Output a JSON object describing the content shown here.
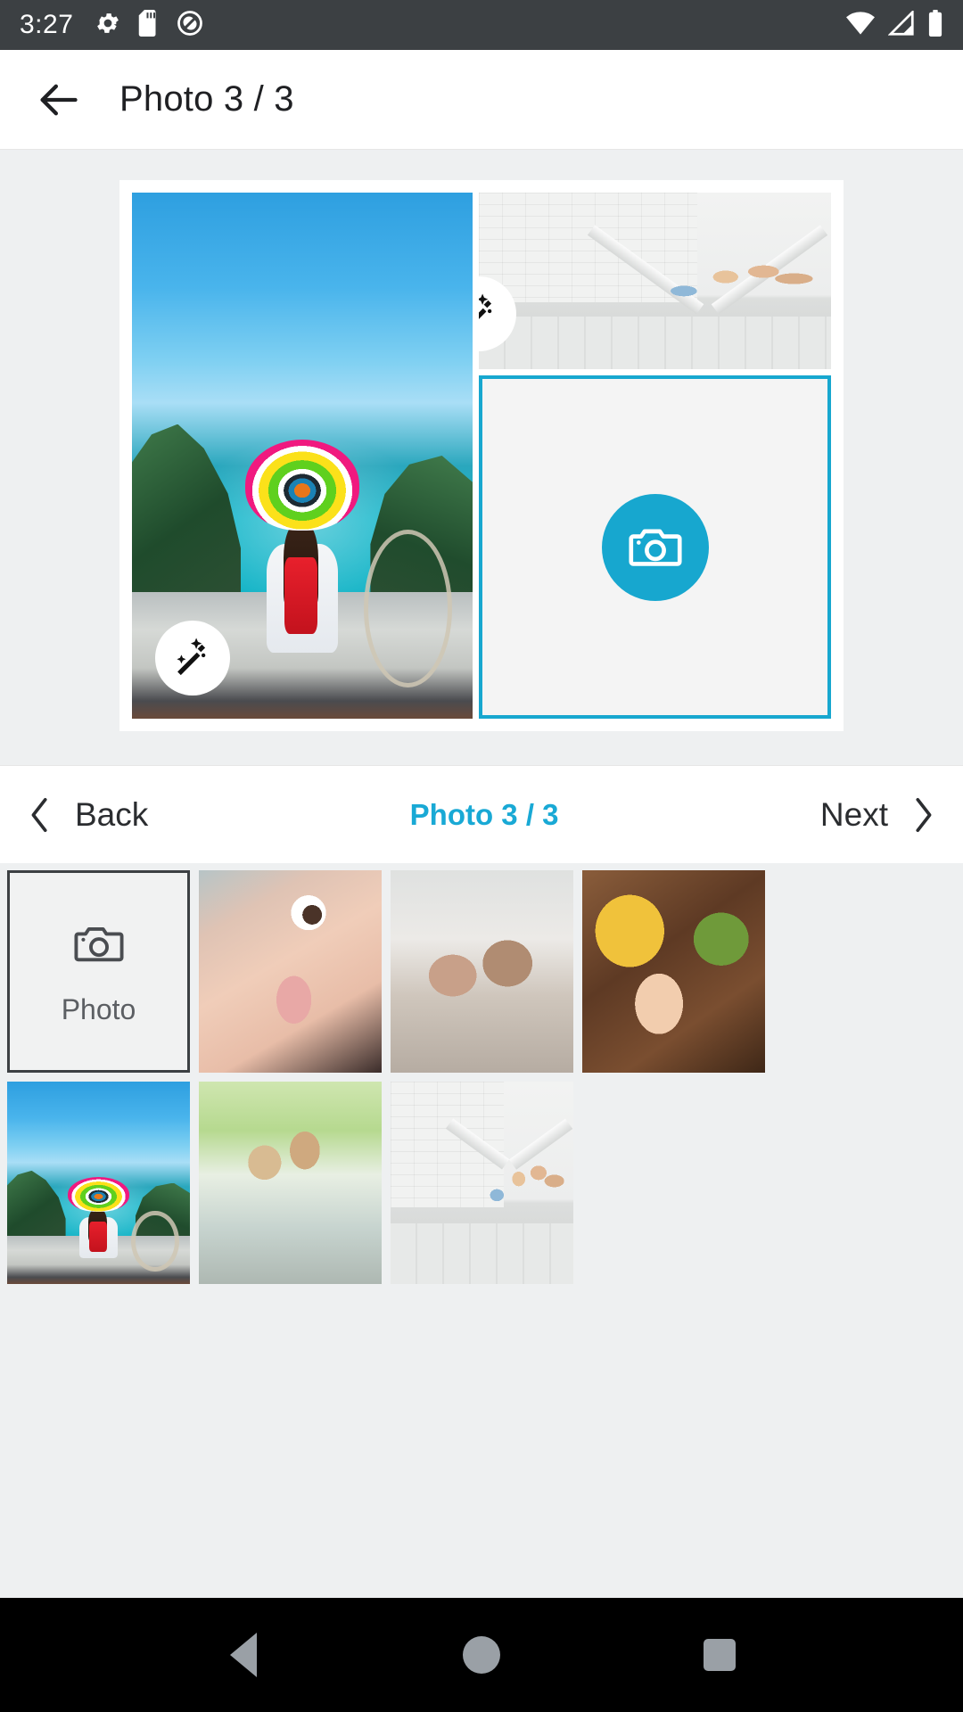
{
  "status_bar": {
    "time": "3:27",
    "left_icons": [
      "gear-icon",
      "sd-card-icon",
      "do-not-disturb-icon"
    ],
    "right_icons": [
      "wifi-icon",
      "cellular-signal-icon",
      "battery-icon"
    ],
    "background_color": "#3c4043"
  },
  "app_bar": {
    "back_label": "back-arrow",
    "title": "Photo 3 / 3"
  },
  "editor": {
    "accent_color": "#17a7cf",
    "canvas_background": "#eef0f1",
    "collage": {
      "cells": [
        {
          "id": "cell-left",
          "state": "filled",
          "photo": "girl-rainbow-hat-boat-beach",
          "magic_wand": true,
          "selected": false
        },
        {
          "id": "cell-top-right",
          "state": "filled",
          "photo": "family-under-paper-roof",
          "magic_wand": true,
          "selected": false
        },
        {
          "id": "cell-bottom-right",
          "state": "empty",
          "photo": "",
          "magic_wand": false,
          "selected": true,
          "add_icon": "camera-icon"
        }
      ]
    }
  },
  "pager": {
    "back_label": "Back",
    "center_label": "Photo 3 / 3",
    "next_label": "Next",
    "prev_icon": "chevron-left-icon",
    "next_icon": "chevron-right-icon",
    "center_color": "#19a9d5"
  },
  "gallery": {
    "add_tile": {
      "label": "Photo",
      "icon": "camera-icon"
    },
    "thumbnails": [
      {
        "name": "child-smiling-closeup",
        "art": "t-eye"
      },
      {
        "name": "father-and-child-on-bed",
        "art": "t-dad"
      },
      {
        "name": "hands-together-outdoors",
        "art": "t-hands"
      },
      {
        "name": "girl-rainbow-hat-boat-beach",
        "art": "art-beach"
      },
      {
        "name": "family-selfie-outdoors",
        "art": "t-fam"
      },
      {
        "name": "family-under-paper-roof",
        "art": "art-house"
      }
    ]
  },
  "nav_bar": {
    "buttons": [
      "back-triangle-icon",
      "home-circle-icon",
      "recents-square-icon"
    ],
    "background_color": "#000000"
  }
}
